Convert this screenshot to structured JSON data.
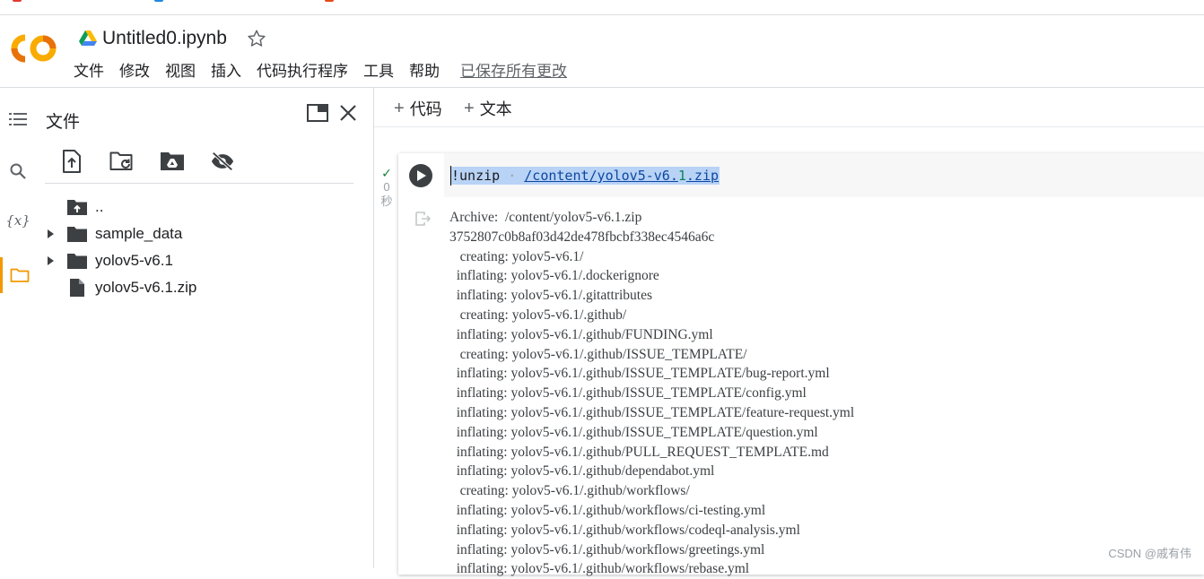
{
  "header": {
    "title": "Untitled0.ipynb",
    "menu": [
      "文件",
      "修改",
      "视图",
      "插入",
      "代码执行程序",
      "工具",
      "帮助"
    ],
    "saved_status": "已保存所有更改"
  },
  "files_panel": {
    "title": "文件",
    "tree": [
      {
        "name": "..",
        "type": "parent",
        "expandable": false
      },
      {
        "name": "sample_data",
        "type": "folder",
        "expandable": true
      },
      {
        "name": "yolov5-v6.1",
        "type": "folder",
        "expandable": true
      },
      {
        "name": "yolov5-v6.1.zip",
        "type": "file",
        "expandable": false
      }
    ]
  },
  "toolbar": {
    "add_code_label": "代码",
    "add_text_label": "文本"
  },
  "cell": {
    "exec_time": "0",
    "exec_unit": "秒",
    "code_prefix": "!unzip",
    "code_path_a": "/content/yolov5-v6.",
    "code_path_num": "1",
    "code_path_b": ".zip",
    "output_lines": [
      "Archive:  /content/yolov5-v6.1.zip",
      "3752807c0b8af03d42de478fbcbf338ec4546a6c",
      "   creating: yolov5-v6.1/",
      "  inflating: yolov5-v6.1/.dockerignore",
      "  inflating: yolov5-v6.1/.gitattributes",
      "   creating: yolov5-v6.1/.github/",
      "  inflating: yolov5-v6.1/.github/FUNDING.yml",
      "   creating: yolov5-v6.1/.github/ISSUE_TEMPLATE/",
      "  inflating: yolov5-v6.1/.github/ISSUE_TEMPLATE/bug-report.yml",
      "  inflating: yolov5-v6.1/.github/ISSUE_TEMPLATE/config.yml",
      "  inflating: yolov5-v6.1/.github/ISSUE_TEMPLATE/feature-request.yml",
      "  inflating: yolov5-v6.1/.github/ISSUE_TEMPLATE/question.yml",
      "  inflating: yolov5-v6.1/.github/PULL_REQUEST_TEMPLATE.md",
      "  inflating: yolov5-v6.1/.github/dependabot.yml",
      "   creating: yolov5-v6.1/.github/workflows/",
      "  inflating: yolov5-v6.1/.github/workflows/ci-testing.yml",
      "  inflating: yolov5-v6.1/.github/workflows/codeql-analysis.yml",
      "  inflating: yolov5-v6.1/.github/workflows/greetings.yml",
      "  inflating: yolov5-v6.1/.github/workflows/rebase.yml"
    ]
  },
  "watermark": "CSDN @戚有伟",
  "colors": {
    "accent_orange": "#f29900",
    "logo_orange": "#f9ab00",
    "logo_dark_orange": "#e8710a",
    "selection_blue": "#b8d3f5",
    "success_green": "#188038"
  }
}
